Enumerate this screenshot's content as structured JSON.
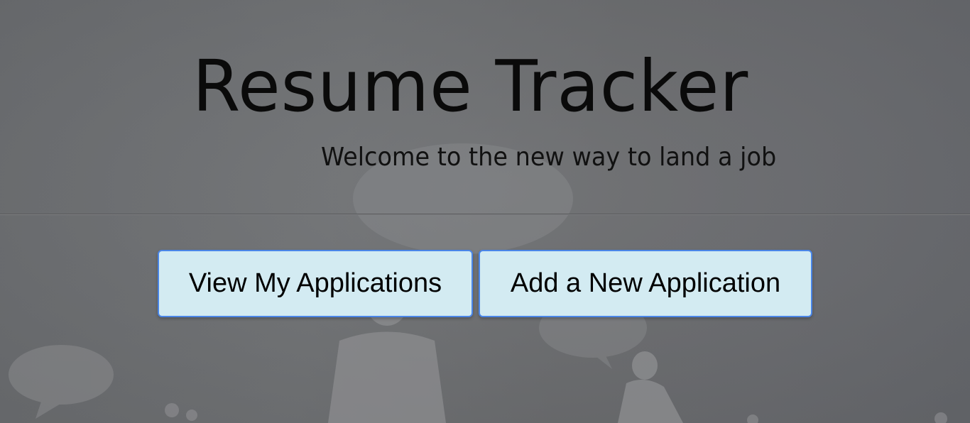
{
  "header": {
    "title": "Resume Tracker",
    "subtitle": "Welcome to the new way to land a job"
  },
  "actions": {
    "view_label": "View My Applications",
    "add_label": "Add a New Application"
  },
  "colors": {
    "button_background": "#d3ebf2",
    "button_border": "#4a86e8",
    "page_background": "#6e7073"
  }
}
